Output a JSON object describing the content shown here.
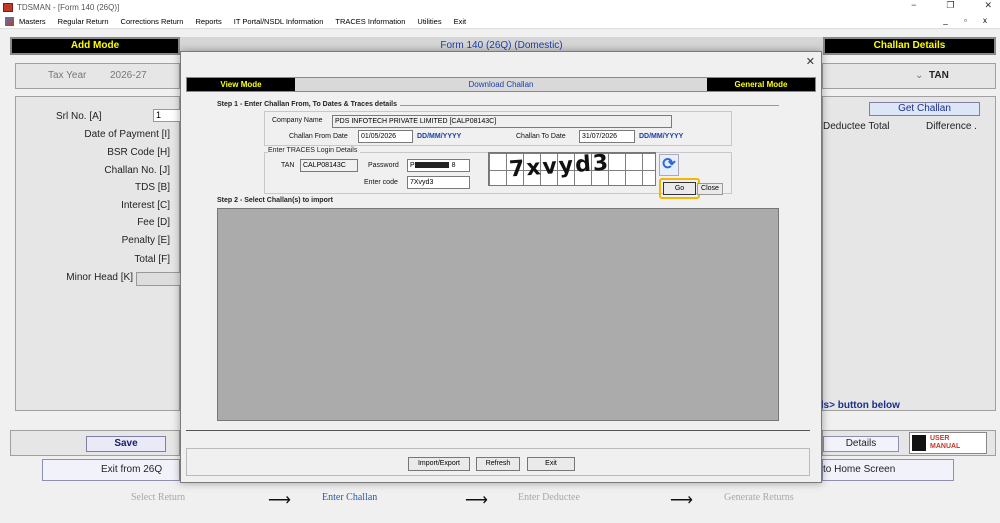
{
  "window": {
    "title": "TDSMAN - [Form 140 (26Q)]",
    "controls": [
      "−",
      "❐",
      "✕"
    ]
  },
  "menu": {
    "items": [
      "Masters",
      "Regular Return",
      "Corrections Return",
      "Reports",
      "IT Portal/NSDL Information",
      "TRACES Information",
      "Utilities",
      "Exit"
    ],
    "mdi_controls": "_ ▫ x"
  },
  "background": {
    "add_mode": "Add Mode",
    "form_title": "Form 140 (26Q) (Domestic)",
    "challan_details": "Challan Details",
    "tax_year_label": "Tax Year",
    "tax_year_value": "2026-27",
    "tan_label": "TAN",
    "srl_no_label": "Srl No. [A]",
    "srl_no_value": "1",
    "get_challan": "Get Challan",
    "deductee_total": "Deductee Total",
    "difference": "Difference .",
    "fields": [
      "Date of Payment [I]",
      "BSR Code [H]",
      "Challan No. [J]",
      "TDS [B]",
      "Interest [C]",
      "Fee [D]",
      "Penalty [E]",
      "Total [F]",
      "Minor Head [K]"
    ],
    "hint_text": "ils> button below",
    "save_button": "Save",
    "details_button": "Details",
    "user_manual": "USER MANUAL",
    "exit_button": "Exit from 26Q",
    "home_button": "to Home Screen"
  },
  "steps": {
    "items": [
      "Select Return",
      "Enter Challan",
      "Enter Deductee",
      "Generate Returns"
    ],
    "active_index": 1
  },
  "dialog": {
    "close_glyph": "✕",
    "view_mode": "View Mode",
    "download_challan": "Download Challan",
    "general_mode": "General Mode",
    "step1_title": "Step 1 - Enter Challan From, To Dates & Traces details",
    "company_name_label": "Company Name",
    "company_name_value": "PDS INFOTECH PRIVATE LIMITED [CALP08143C]",
    "challan_from_label": "Challan From Date",
    "challan_from_value": "01/05/2026",
    "challan_to_label": "Challan To Date",
    "challan_to_value": "31/07/2026",
    "date_format": "DD/MM/YYYY",
    "traces_title": "Enter TRACES Login Details",
    "tan_label": "TAN",
    "tan_value": "CALP08143C",
    "password_label": "Password",
    "password_prefix": "P",
    "password_suffix": "8",
    "enter_code_label": "Enter code",
    "enter_code_value": "7Xvyd3",
    "captcha_text": "7xvyd3",
    "refresh_icon": "⟳",
    "go_button": "Go",
    "close_button": "Close",
    "step2_title": "Step 2 - Select Challan(s) to import",
    "import_export_button": "Import/Export",
    "refresh_button": "Refresh",
    "exit_button": "Exit"
  },
  "colors": {
    "mode_bg": "#000000",
    "mode_text": "#ffff00",
    "title_blue": "#1a3fa8",
    "highlight": "#f2b705",
    "grid_gray": "#ababab"
  }
}
